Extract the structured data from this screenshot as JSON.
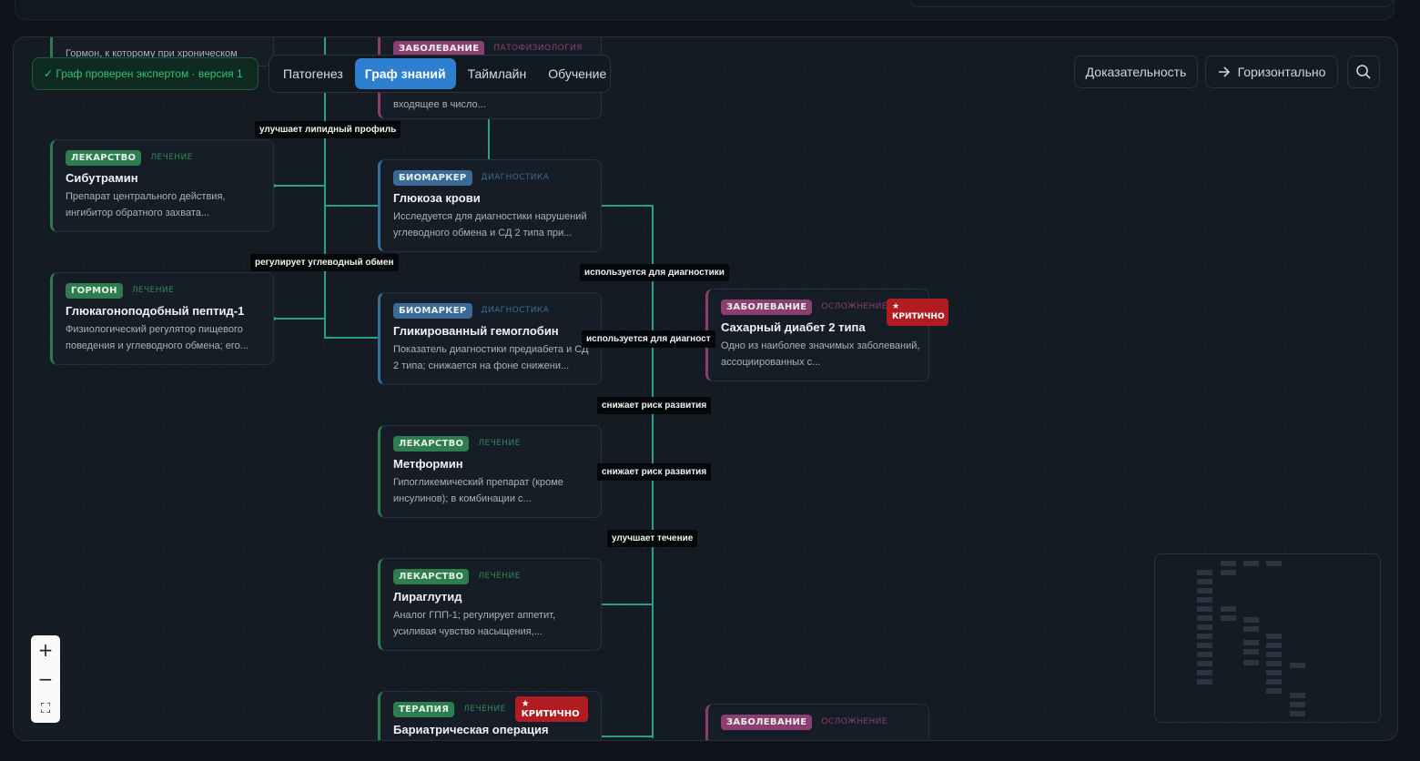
{
  "toolbar": {
    "verified_badge": "✓ Граф проверен экспертом · версия 1",
    "tabs": [
      "Патогенез",
      "Граф знаний",
      "Таймлайн",
      "Обучение"
    ],
    "active_tab": "Граф знаний",
    "evidence_button": "Доказательность",
    "layout_button": "Горизонтально",
    "layout_icon": "arrow-right-icon",
    "search_icon": "search-icon"
  },
  "zoom": {
    "in": "+",
    "out": "−",
    "fit": "⛶"
  },
  "nodes": {
    "top_left_desc": "Гормон, к которому при хроническом",
    "top_center": {
      "tag": "ЗАБОЛЕВАНИЕ",
      "sub": "ПАТОФИЗИОЛОГИЯ",
      "desc": "входящее в число..."
    },
    "sibutramine": {
      "tag": "ЛЕКАРСТВО",
      "sub": "ЛЕЧЕНИЕ",
      "title": "Сибутрамин",
      "desc": "Препарат центрального действия, ингибитор обратного захвата..."
    },
    "glp1": {
      "tag": "ГОРМОН",
      "sub": "ЛЕЧЕНИЕ",
      "title": "Глюкагоноподобный пептид-1",
      "desc": "Физиологический регулятор пищевого поведения и углеводного обмена; его..."
    },
    "glucose": {
      "tag": "БИОМАРКЕР",
      "sub": "ДИАГНОСТИКА",
      "title": "Глюкоза крови",
      "desc": "Исследуется для диагностики нарушений углеводного обмена и СД 2 типа при..."
    },
    "hba1c": {
      "tag": "БИОМАРКЕР",
      "sub": "ДИАГНОСТИКА",
      "title": "Гликированный гемоглобин",
      "desc": "Показатель диагностики предиабета и СД 2 типа; снижается на фоне снижени..."
    },
    "metformin": {
      "tag": "ЛЕКАРСТВО",
      "sub": "ЛЕЧЕНИЕ",
      "title": "Метформин",
      "desc": "Гипогликемический препарат (кроме инсулинов); в комбинации с..."
    },
    "liraglutide": {
      "tag": "ЛЕКАРСТВО",
      "sub": "ЛЕЧЕНИЕ",
      "title": "Лираглутид",
      "desc": "Аналог ГПП-1; регулирует аппетит, усиливая чувство насыщения,..."
    },
    "bariatric": {
      "tag": "ТЕРАПИЯ",
      "sub": "ЛЕЧЕНИЕ",
      "crit": "★ КРИТИЧНО",
      "title": "Бариатрическая операция"
    },
    "diabetes": {
      "tag": "ЗАБОЛЕВАНИЕ",
      "sub": "ОСЛОЖНЕНИЕ",
      "crit": "★ КРИТИЧНО",
      "title": "Сахарный диабет 2 типа",
      "desc": "Одно из наиболее значимых заболеваний, ассоциированных с..."
    },
    "bottom_right": {
      "tag": "ЗАБОЛЕВАНИЕ",
      "sub": "ОСЛОЖНЕНИЕ"
    }
  },
  "edge_labels": {
    "lipid": "улучшает липидный профиль",
    "carb": "регулирует углеводный обмен",
    "diag1": "используется для диагностики",
    "diag2": "используется для диагност",
    "risk1": "снижает риск развития",
    "risk2": "снижает риск развития",
    "course": "улучшает течение"
  },
  "colors": {
    "edge": "#2a9d8f",
    "drug": "#2e7d4f",
    "biomarker": "#3b6a96",
    "disease": "#8b3e72",
    "critical": "#b01c22",
    "active_tab": "#2f7fd1"
  }
}
